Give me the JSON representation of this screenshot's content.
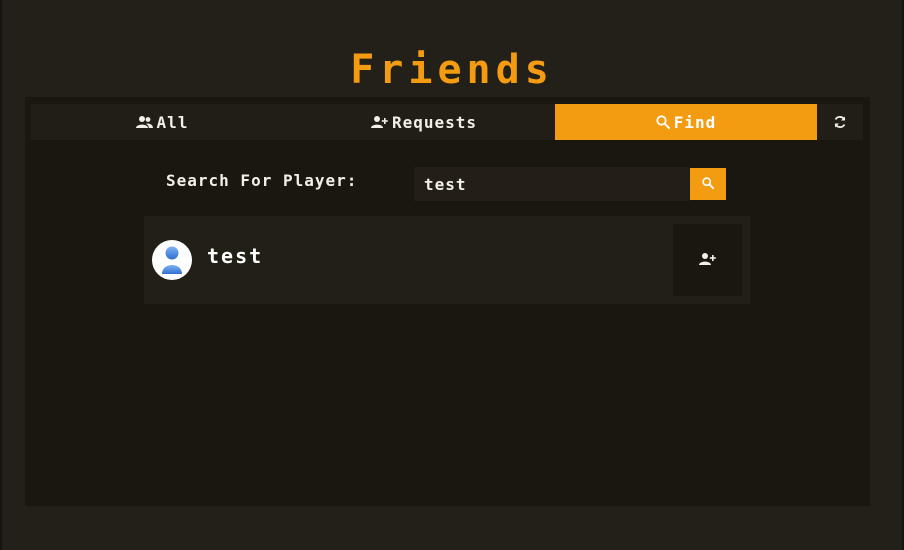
{
  "page": {
    "title": "Friends"
  },
  "tabs": [
    {
      "label": "All",
      "icon": "users-icon",
      "active": false
    },
    {
      "label": "Requests",
      "icon": "user-plus-icon",
      "active": false
    },
    {
      "label": "Find",
      "icon": "search-icon",
      "active": true
    },
    {
      "label": "",
      "icon": "refresh-icon",
      "active": false
    }
  ],
  "search": {
    "label": "Search For Player:",
    "value": "test",
    "button_icon": "search-icon"
  },
  "results": [
    {
      "username": "test",
      "avatar_icon": "default-avatar-icon",
      "action_icon": "user-plus-icon"
    }
  ],
  "colors": {
    "accent": "#f39c12",
    "background": "#232019",
    "panel": "#19170f",
    "card": "#221f17",
    "text": "#f2efe6"
  }
}
